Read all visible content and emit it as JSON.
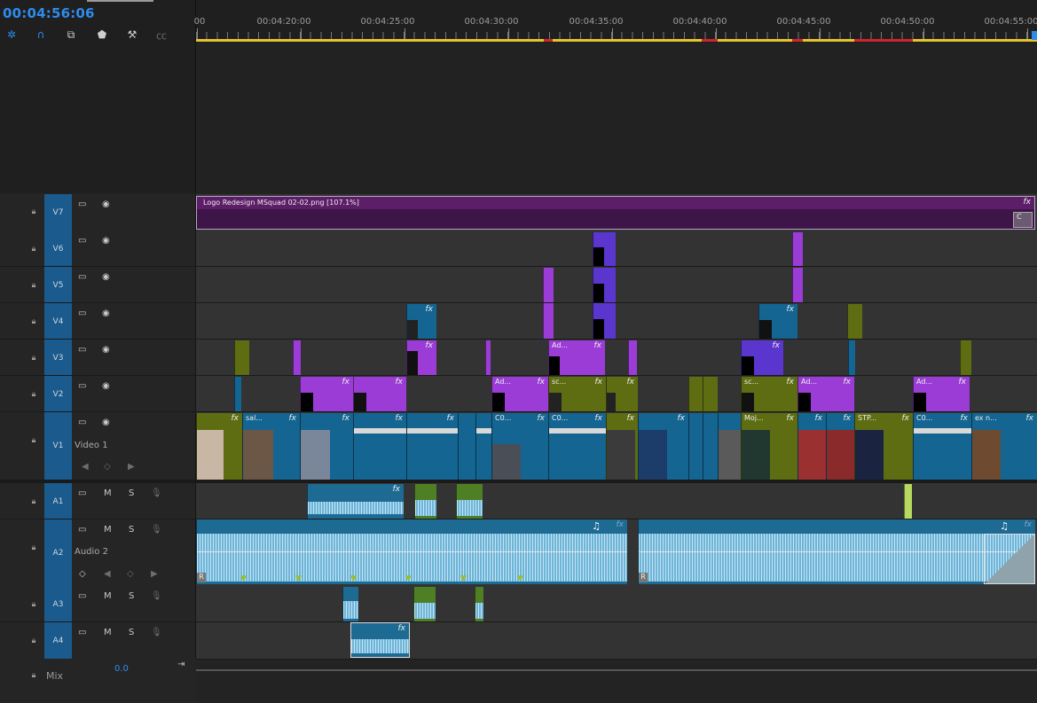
{
  "timecode": "00:04:56:06",
  "tools": [
    "snap-icon",
    "magnet-icon",
    "linked-selection-icon",
    "marker-icon",
    "wrench-icon",
    "captions-icon"
  ],
  "ruler": {
    "labels": [
      "00",
      "00:04:20:00",
      "00:04:25:00",
      "00:04:30:00",
      "00:04:35:00",
      "00:04:40:00",
      "00:04:45:00",
      "00:04:50:00",
      "00:04:55:00"
    ]
  },
  "tracks": {
    "v7": {
      "name": "V7"
    },
    "v6": {
      "name": "V6"
    },
    "v5": {
      "name": "V5"
    },
    "v4": {
      "name": "V4"
    },
    "v3": {
      "name": "V3"
    },
    "v2": {
      "name": "V2"
    },
    "v1": {
      "name": "V1",
      "label": "Video 1"
    },
    "a1": {
      "name": "A1"
    },
    "a2": {
      "name": "A2",
      "label": "Audio 2"
    },
    "a3": {
      "name": "A3"
    },
    "a4": {
      "name": "A4"
    }
  },
  "track_buttons": {
    "mute": "M",
    "solo": "S"
  },
  "mix": {
    "label": "Mix",
    "volume": "0.0"
  },
  "clips": {
    "logo": "Logo Redesign MSquad 02-02.png [107.1%]",
    "logo_end": "C",
    "fx": "fx",
    "v2_ad1": "Ad...",
    "v2_sc1": "sc...",
    "v2_sc2": "sc...",
    "v2_ad2": "Ad...",
    "v2_ad3": "Ad...",
    "v3_ad": "Ad...",
    "v1_sal": "sal...",
    "v1_c01": "C0...",
    "v1_c02": "C0...",
    "v1_moj": "Moj...",
    "v1_stp": "STP...",
    "v1_c03": "C0...",
    "v1_exn": "ex n...",
    "r_badge": "R"
  }
}
